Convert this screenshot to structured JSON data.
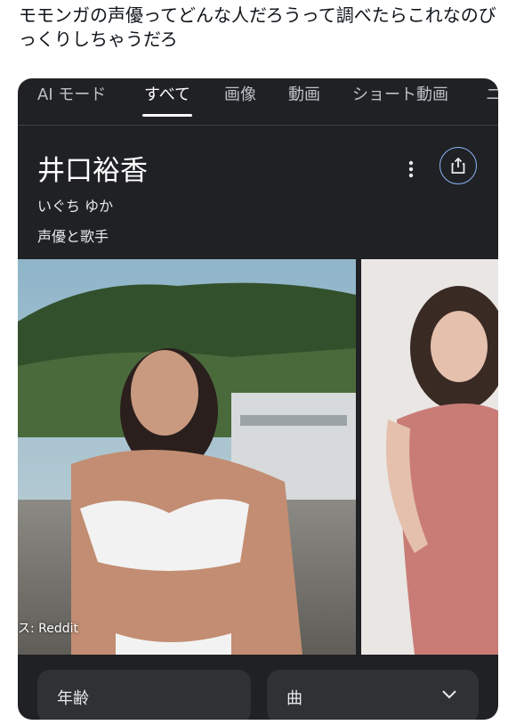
{
  "tweet": {
    "text": "モモンガの声優ってどんな人だろうって調べたらこれなのびっくりしちゃうだろ"
  },
  "search": {
    "tabs": [
      {
        "label": "AI モード",
        "active": false
      },
      {
        "label": "すべて",
        "active": true
      },
      {
        "label": "画像",
        "active": false
      },
      {
        "label": "動画",
        "active": false
      },
      {
        "label": "ショート動画",
        "active": false
      },
      {
        "label": "ニ",
        "active": false
      }
    ]
  },
  "knowledge_panel": {
    "name": "井口裕香",
    "reading": "いぐち ゆか",
    "description": "声優と歌手",
    "image_source": "ス: Reddit",
    "chips": [
      {
        "label": "年齢"
      },
      {
        "label": "曲"
      }
    ]
  },
  "colors": {
    "card_background": "#202124",
    "chip_background": "#303134",
    "share_accent": "#8ab4f8"
  }
}
